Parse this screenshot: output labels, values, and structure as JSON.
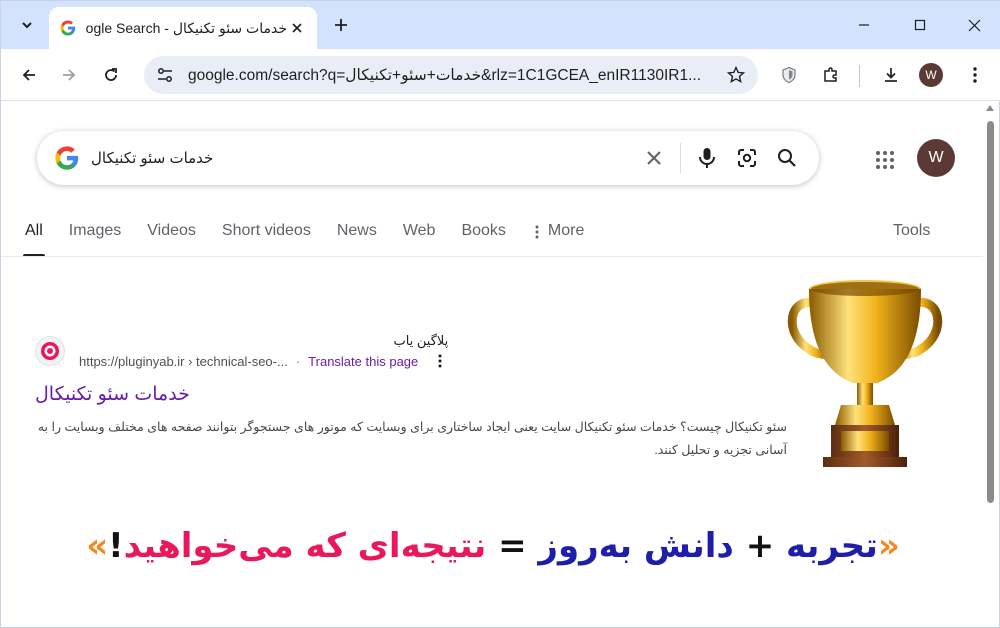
{
  "browser": {
    "tab_title": "خدمات سئو تکنیکال - Google Search",
    "url": "google.com/search?q=خدمات+سئو+تکنیکال&rlz=1C1GCEA_enIR1130IR1...",
    "profile_initial": "W"
  },
  "search": {
    "query": "خدمات سئو تکنیکال",
    "profile_initial": "W",
    "tabs": [
      {
        "label": "All"
      },
      {
        "label": "Images"
      },
      {
        "label": "Videos"
      },
      {
        "label": "Short videos"
      },
      {
        "label": "News"
      },
      {
        "label": "Web"
      },
      {
        "label": "Books"
      },
      {
        "label": "More"
      }
    ],
    "tools_label": "Tools"
  },
  "result": {
    "site_name": "پلاگین یاب",
    "url": "https://pluginyab.ir › technical-seo-...",
    "translate": "Translate this page",
    "title": "خدمات سئو تکنیکال",
    "snippet": "سئو تکنیکال چیست؟ خدمات سئو تکنیکال سایت یعنی ایجاد ساختاری برای وبسایت که موتور های جستجوگر بتوانند صفحه های مختلف وبسایت را به آسانی تجزیه و تحلیل کنند."
  },
  "slogan": {
    "open_quote": "«",
    "part1": "تجربه",
    "plus": "+",
    "part2": "دانش به‌روز",
    "equals": "=",
    "part3": "نتیجه‌ای که می‌خواهید",
    "exclaim": "!",
    "close_quote": "»"
  },
  "colors": {
    "tab_strip": "#d3e3fd",
    "omnibox": "#e9eef6",
    "visited_link": "#681da8",
    "slogan_blue": "#1e1ea8",
    "slogan_pink": "#e8185b",
    "slogan_quote": "#f5871f",
    "avatar": "#5b3a35"
  }
}
